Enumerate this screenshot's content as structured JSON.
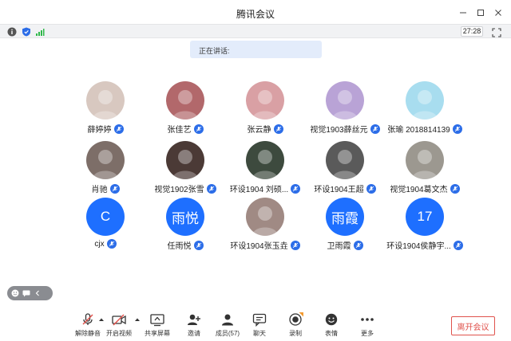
{
  "window": {
    "title": "腾讯会议"
  },
  "infobar": {
    "timer": "27:28"
  },
  "speaking": {
    "label": "正在讲话:"
  },
  "participants": [
    {
      "name": "薛婷婷",
      "avatar_text": "",
      "avatar_color": "#d8c8c0"
    },
    {
      "name": "张佳艺",
      "avatar_text": "",
      "avatar_color": "#b2686b"
    },
    {
      "name": "张云静",
      "avatar_text": "",
      "avatar_color": "#d9a0a4"
    },
    {
      "name": "视觉1903薛丝元",
      "avatar_text": "",
      "avatar_color": "#b9a3d6"
    },
    {
      "name": "张瑜 2018814139",
      "avatar_text": "",
      "avatar_color": "#a8ddef"
    },
    {
      "name": "肖驰",
      "avatar_text": "",
      "avatar_color": "#7d6e68"
    },
    {
      "name": "视觉1902张雪",
      "avatar_text": "",
      "avatar_color": "#4b3a36"
    },
    {
      "name": "环设1904 刘硕...",
      "avatar_text": "",
      "avatar_color": "#3d4a3e"
    },
    {
      "name": "环设1904王超",
      "avatar_text": "",
      "avatar_color": "#5a5a5a"
    },
    {
      "name": "视觉1904葛文杰",
      "avatar_text": "",
      "avatar_color": "#9c9890"
    },
    {
      "name": "cjx",
      "avatar_text": "C",
      "avatar_color": "#1e6fff"
    },
    {
      "name": "任雨悦",
      "avatar_text": "雨悦",
      "avatar_color": "#1e6fff"
    },
    {
      "name": "环设1904张玉垚",
      "avatar_text": "",
      "avatar_color": "#a08a84"
    },
    {
      "name": "卫雨霞",
      "avatar_text": "雨霞",
      "avatar_color": "#1e6fff"
    },
    {
      "name": "环设1904侯静宇...",
      "avatar_text": "17",
      "avatar_color": "#1e6fff"
    }
  ],
  "toolbar": {
    "unmute": "解除静音",
    "video": "开启视频",
    "share": "共享屏幕",
    "invite": "邀请",
    "members": "成员(57)",
    "chat": "聊天",
    "record": "录制",
    "emoji": "表情",
    "more": "更多",
    "leave": "离开会议"
  },
  "colors": {
    "accent": "#1e6fff",
    "leave": "#e0524c",
    "mic": "#2c6de8"
  }
}
